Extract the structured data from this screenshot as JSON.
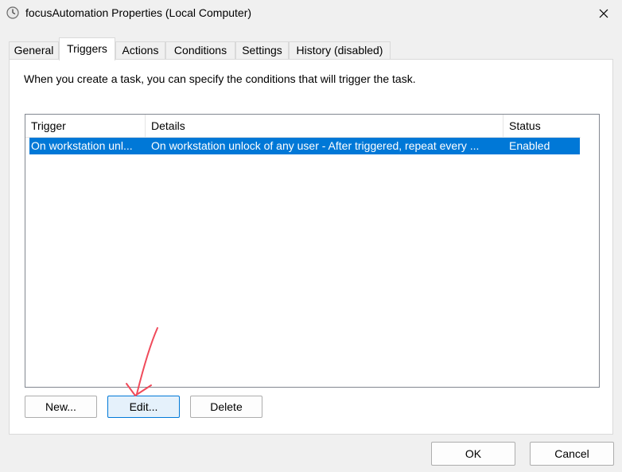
{
  "window": {
    "title": "focusAutomation Properties (Local Computer)"
  },
  "tabs": [
    {
      "label": "General"
    },
    {
      "label": "Triggers"
    },
    {
      "label": "Actions"
    },
    {
      "label": "Conditions"
    },
    {
      "label": "Settings"
    },
    {
      "label": "History (disabled)"
    }
  ],
  "triggers": {
    "intro": "When you create a task, you can specify the conditions that will trigger the task.",
    "columns": {
      "trigger": "Trigger",
      "details": "Details",
      "status": "Status"
    },
    "rows": [
      {
        "trigger": "On workstation unl...",
        "details": "On workstation unlock of any user - After triggered, repeat every ...",
        "status": "Enabled"
      }
    ],
    "buttons": {
      "new": "New...",
      "edit": "Edit...",
      "delete": "Delete"
    }
  },
  "footer": {
    "ok": "OK",
    "cancel": "Cancel"
  },
  "colors": {
    "selection": "#0078d7",
    "annotation_arrow": "#f04a5a"
  }
}
